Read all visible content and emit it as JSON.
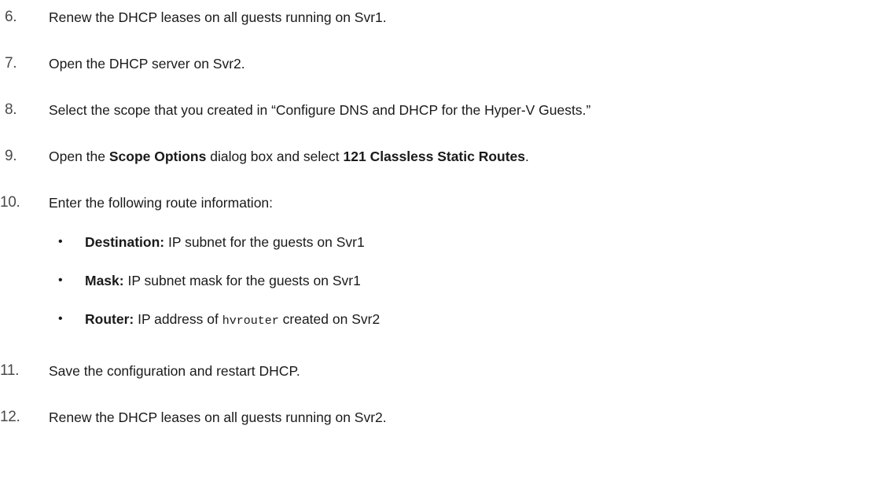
{
  "steps": [
    {
      "num": "6.",
      "text": "Renew the DHCP leases on all guests running on Svr1."
    },
    {
      "num": "7.",
      "text": "Open the DHCP server on Svr2."
    },
    {
      "num": "8.",
      "text": "Select the scope that you created in “Configure DNS and DHCP for the Hyper-V Guests.”"
    },
    {
      "num": "9.",
      "pre": "Open the ",
      "bold1": "Scope Options",
      "mid": " dialog box and select ",
      "bold2": "121 Classless Static Routes",
      "post": "."
    },
    {
      "num": "10.",
      "text": "Enter the following route information:"
    },
    {
      "num": "11.",
      "text": "Save the configuration and restart DHCP."
    },
    {
      "num": "12.",
      "text": "Renew the DHCP leases on all guests running on Svr2."
    }
  ],
  "route_items": [
    {
      "bullet": "•",
      "label": "Destination:",
      "text": " IP subnet for the guests on Svr1"
    },
    {
      "bullet": "•",
      "label": "Mask:",
      "text": " IP subnet mask for the guests on Svr1"
    },
    {
      "bullet": "•",
      "label": "Router:",
      "pre": " IP address of ",
      "code": "hvrouter",
      "post": " created on Svr2"
    }
  ]
}
